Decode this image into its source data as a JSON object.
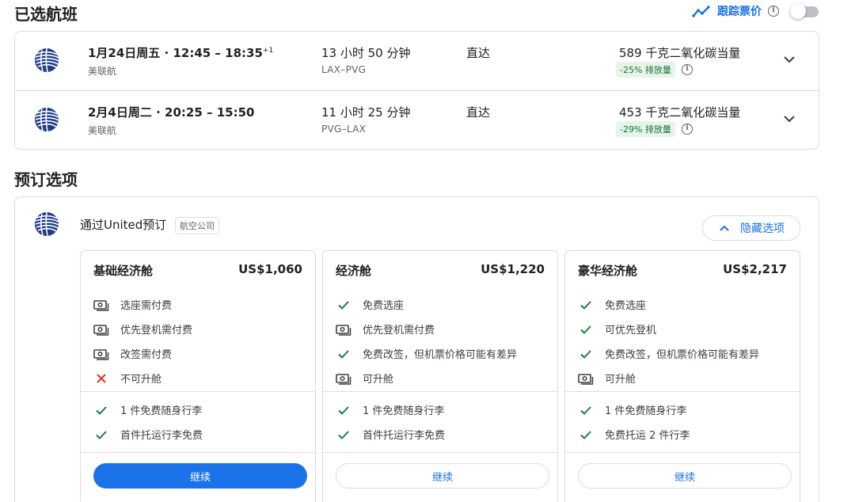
{
  "selected_flights": {
    "title": "已选航班",
    "track_label": "跟踪票价",
    "flights": [
      {
        "date_time": "1月24日周五 · 12:45 – 18:35",
        "day_offset": "+1",
        "airline": "美联航",
        "duration": "13 小时 50 分钟",
        "route": "LAX–PVG",
        "stops": "直达",
        "emissions": "589 千克二氧化碳当量",
        "emissions_badge": "-25% 排放量"
      },
      {
        "date_time": "2月4日周二 · 20:25 – 15:50",
        "day_offset": "",
        "airline": "美联航",
        "duration": "11 小时 25 分钟",
        "route": "PVG–LAX",
        "stops": "直达",
        "emissions": "453 千克二氧化碳当量",
        "emissions_badge": "-29% 排放量"
      }
    ]
  },
  "booking": {
    "title": "预订选项",
    "via": "通过United预订",
    "airline_tag": "航空公司",
    "hide_options": "隐藏选项",
    "fares": [
      {
        "name": "基础经济舱",
        "price": "US$1,060",
        "features": [
          {
            "icon": "money-icon",
            "text": "选座需付费"
          },
          {
            "icon": "money-icon",
            "text": "优先登机需付费"
          },
          {
            "icon": "money-icon",
            "text": "改签需付费"
          },
          {
            "icon": "cross-icon",
            "text": "不可升舱"
          }
        ],
        "bags": [
          {
            "icon": "check-icon",
            "text": "1 件免费随身行李"
          },
          {
            "icon": "check-icon",
            "text": "首件托运行李免费"
          }
        ],
        "cta": "继续",
        "primary": true
      },
      {
        "name": "经济舱",
        "price": "US$1,220",
        "features": [
          {
            "icon": "check-icon",
            "text": "免费选座"
          },
          {
            "icon": "money-icon",
            "text": "优先登机需付费"
          },
          {
            "icon": "check-icon",
            "text": "免费改签，但机票价格可能有差异"
          },
          {
            "icon": "money-icon",
            "text": "可升舱"
          }
        ],
        "bags": [
          {
            "icon": "check-icon",
            "text": "1 件免费随身行李"
          },
          {
            "icon": "check-icon",
            "text": "首件托运行李免费"
          }
        ],
        "cta": "继续",
        "primary": false
      },
      {
        "name": "豪华经济舱",
        "price": "US$2,217",
        "features": [
          {
            "icon": "check-icon",
            "text": "免费选座"
          },
          {
            "icon": "check-icon",
            "text": "可优先登机"
          },
          {
            "icon": "check-icon",
            "text": "免费改签，但机票价格可能有差异"
          },
          {
            "icon": "money-icon",
            "text": "可升舱"
          }
        ],
        "bags": [
          {
            "icon": "check-icon",
            "text": "1 件免费随身行李"
          },
          {
            "icon": "check-icon",
            "text": "免费托运 2 件行李"
          }
        ],
        "cta": "继续",
        "primary": false
      }
    ]
  },
  "colors": {
    "accent": "#1a73e8",
    "check": "#188038",
    "cross": "#d93025",
    "badge_bg": "#e6f4ea",
    "badge_text": "#137333",
    "border": "#dadce0"
  }
}
